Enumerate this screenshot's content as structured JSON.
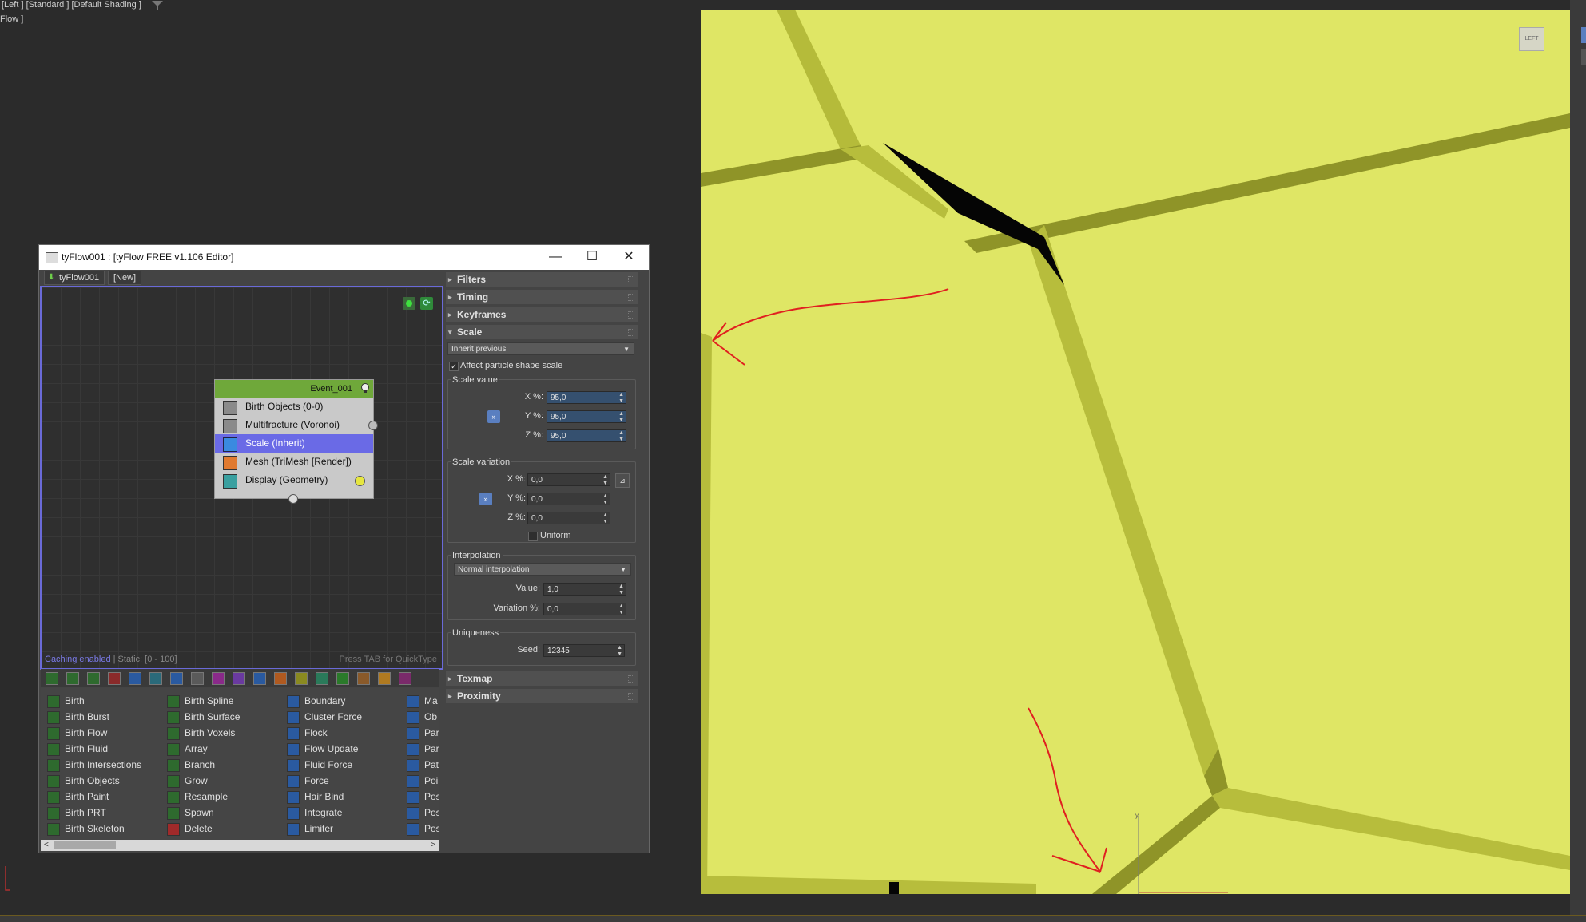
{
  "viewport": {
    "label": "[Left ] [Standard ] [Default Shading ]",
    "label2": "Flow ]",
    "view_cube": "LEFT"
  },
  "editor": {
    "title": "tyFlow001 : [tyFlow FREE v1.106 Editor]",
    "tabs": [
      "tyFlow001",
      "[New]"
    ],
    "graph": {
      "event_name": "Event_001",
      "operators": [
        {
          "label": "Birth Objects (0-0)",
          "color": "#8a8a8a"
        },
        {
          "label": "Multifracture (Voronoi)",
          "color": "#8a8a8a"
        },
        {
          "label": "Scale (Inherit)",
          "color": "#3a8ae0"
        },
        {
          "label": "Mesh (TriMesh [Render])",
          "color": "#e07a30"
        },
        {
          "label": "Display (Geometry)",
          "color": "#3aa0a0"
        }
      ],
      "status_caching": "Caching enabled",
      "status_static": " | Static: [0 - 100]",
      "hint": "Press TAB for QuickType"
    },
    "operator_list": {
      "col1": [
        "Birth",
        "Birth Burst",
        "Birth Flow",
        "Birth Fluid",
        "Birth Intersections",
        "Birth Objects",
        "Birth Paint",
        "Birth PRT",
        "Birth Skeleton"
      ],
      "col2": [
        "Birth Spline",
        "Birth Surface",
        "Birth Voxels",
        "Array",
        "Branch",
        "Grow",
        "Resample",
        "Spawn",
        "Delete"
      ],
      "col3": [
        "Boundary",
        "Cluster Force",
        "Flock",
        "Flow Update",
        "Fluid Force",
        "Force",
        "Hair Bind",
        "Integrate",
        "Limiter"
      ],
      "col4": [
        "Ma",
        "Ob",
        "Par",
        "Par",
        "Pat",
        "Poi",
        "Pos",
        "Pos",
        "Pos"
      ]
    },
    "rollouts": {
      "filters": "Filters",
      "timing": "Timing",
      "keyframes": "Keyframes",
      "scale": "Scale",
      "scale_mode": "Inherit previous",
      "affect_shape": "Affect particle shape scale",
      "scale_value_group": "Scale value",
      "x_label": "X %:",
      "y_label": "Y %:",
      "z_label": "Z %:",
      "x_value": "95,0",
      "y_value": "95,0",
      "z_value": "95,0",
      "variation_group": "Scale variation",
      "vx_value": "0,0",
      "vy_value": "0,0",
      "vz_value": "0,0",
      "uniform": "Uniform",
      "interp_group": "Interpolation",
      "interp_mode": "Normal interpolation",
      "value_label": "Value:",
      "value": "1,0",
      "variation_label": "Variation %:",
      "variation": "0,0",
      "uniq_group": "Uniqueness",
      "seed_label": "Seed:",
      "seed": "12345",
      "texmap": "Texmap",
      "proximity": "Proximity",
      "link_glyph": "»"
    }
  },
  "colors": {
    "viewport_yellow": "#dfe665",
    "crack_dark": "#8f9428",
    "event_header": "#6fa83a",
    "selected_op": "#6a6ae6",
    "annotation_red": "#e02020"
  }
}
